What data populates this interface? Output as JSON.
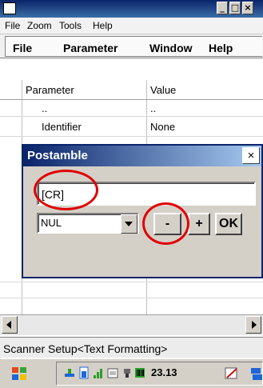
{
  "window": {
    "buttons": {
      "minimize": "_",
      "maximize": "□",
      "close": "×"
    }
  },
  "outer_menu": [
    "File",
    "Zoom",
    "Tools",
    "Help"
  ],
  "app_menu": [
    "File",
    "Parameter",
    "Window",
    "Help"
  ],
  "grid": {
    "columns": [
      "Parameter",
      "Value"
    ],
    "rows": [
      {
        "parameter": "..",
        "value": ".."
      },
      {
        "parameter": "Identifier",
        "value": "None"
      }
    ]
  },
  "dialog": {
    "title": "Postamble",
    "close_label": "×",
    "text_value": "[CR]",
    "select_value": "NUL",
    "minus_label": "-",
    "plus_label": "+",
    "ok_label": "OK"
  },
  "status_text": "Scanner Setup<Text Formatting>",
  "taskbar": {
    "clock": "23.13"
  },
  "colors": {
    "annotation": "#e00000",
    "title_bar": "#0a246a"
  }
}
